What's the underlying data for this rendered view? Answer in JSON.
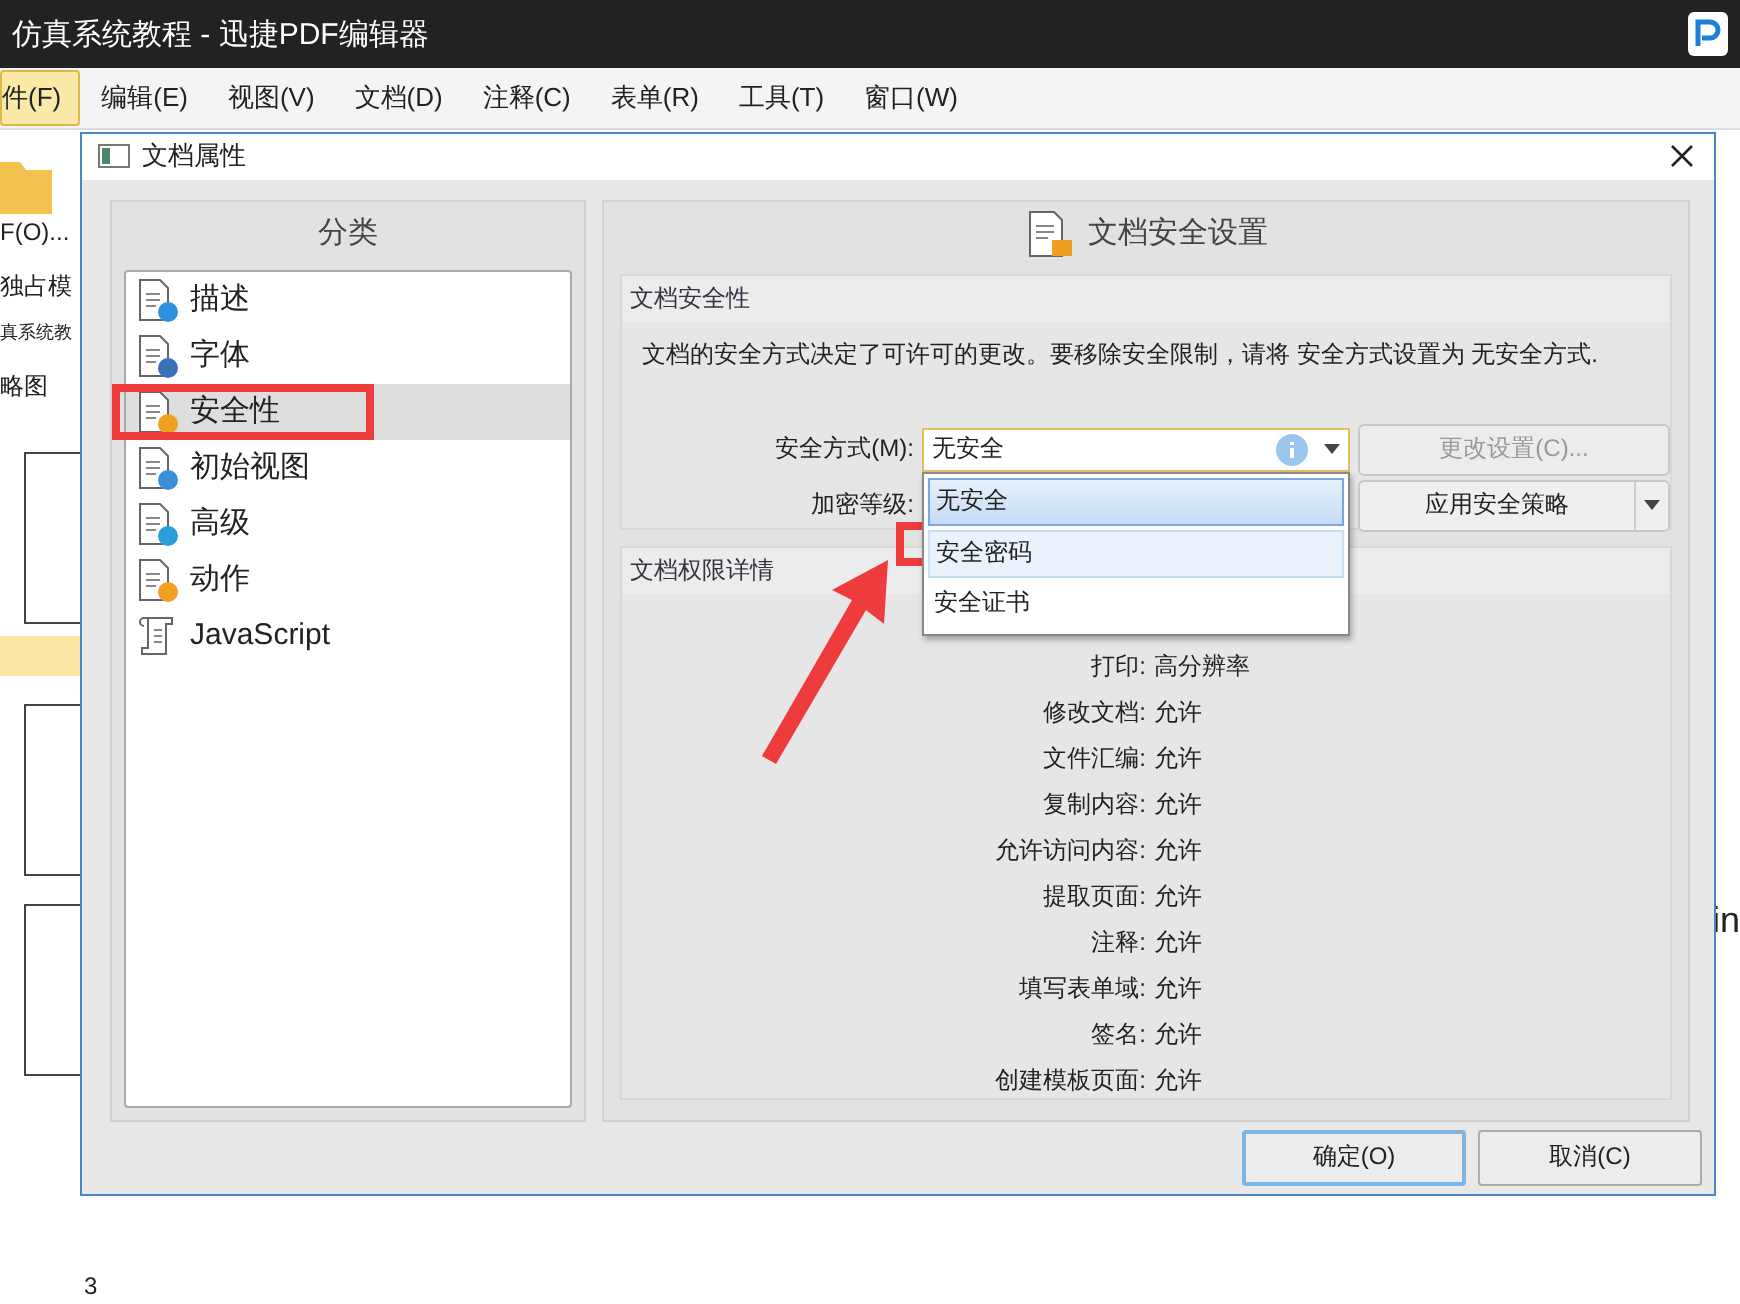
{
  "window": {
    "title": "仿真系统教程 - 迅捷PDF编辑器"
  },
  "menu": [
    {
      "label": "件(F)",
      "selected": true
    },
    {
      "label": "编辑(E)",
      "selected": false
    },
    {
      "label": "视图(V)",
      "selected": false
    },
    {
      "label": "文档(D)",
      "selected": false
    },
    {
      "label": "注释(C)",
      "selected": false
    },
    {
      "label": "表单(R)",
      "selected": false
    },
    {
      "label": "工具(T)",
      "selected": false
    },
    {
      "label": "窗口(W)",
      "selected": false
    }
  ],
  "sidebar": {
    "open_button": "F(O)...",
    "mode_label": "独占模",
    "tab_label": "真系统教",
    "thumbnails_label": "略图",
    "page_number": "3"
  },
  "right_edge_text": "in",
  "dialog": {
    "title": "文档属性",
    "category_header": "分类",
    "categories": [
      {
        "label": "描述",
        "kind": "info",
        "selected": false
      },
      {
        "label": "字体",
        "kind": "font",
        "selected": false
      },
      {
        "label": "安全性",
        "kind": "lock",
        "selected": true
      },
      {
        "label": "初始视图",
        "kind": "view",
        "selected": false
      },
      {
        "label": "高级",
        "kind": "gear",
        "selected": false
      },
      {
        "label": "动作",
        "kind": "action",
        "selected": false
      },
      {
        "label": "JavaScript",
        "kind": "script",
        "selected": false
      }
    ],
    "panel_title": "文档安全设置",
    "security": {
      "title": "文档安全性",
      "description": "文档的安全方式决定了可许可的更改。要移除安全限制，请将 安全方式设置为 无安全方式.",
      "method_label": "安全方式(M):",
      "method_value": "无安全",
      "level_label": "加密等级:",
      "options": [
        {
          "label": "无安全",
          "selected": true,
          "highlighted": false
        },
        {
          "label": "安全密码",
          "selected": false,
          "highlighted": true
        },
        {
          "label": "安全证书",
          "selected": false,
          "highlighted": false
        }
      ],
      "change_button": {
        "label": "更改设置(C)...",
        "disabled": true
      },
      "apply_button": {
        "label": "应用安全策略",
        "disabled": false
      }
    },
    "permissions": {
      "title": "文档权限详情",
      "rows": [
        {
          "label": "打印:",
          "value": "高分辨率"
        },
        {
          "label": "修改文档:",
          "value": "允许"
        },
        {
          "label": "文件汇编:",
          "value": "允许"
        },
        {
          "label": "复制内容:",
          "value": "允许"
        },
        {
          "label": "允许访问内容:",
          "value": "允许"
        },
        {
          "label": "提取页面:",
          "value": "允许"
        },
        {
          "label": "注释:",
          "value": "允许"
        },
        {
          "label": "填写表单域:",
          "value": "允许"
        },
        {
          "label": "签名:",
          "value": "允许"
        },
        {
          "label": "创建模板页面:",
          "value": "允许"
        }
      ]
    },
    "buttons": [
      {
        "label": "确定(O)",
        "default": true
      },
      {
        "label": "取消(C)",
        "default": false
      }
    ]
  }
}
